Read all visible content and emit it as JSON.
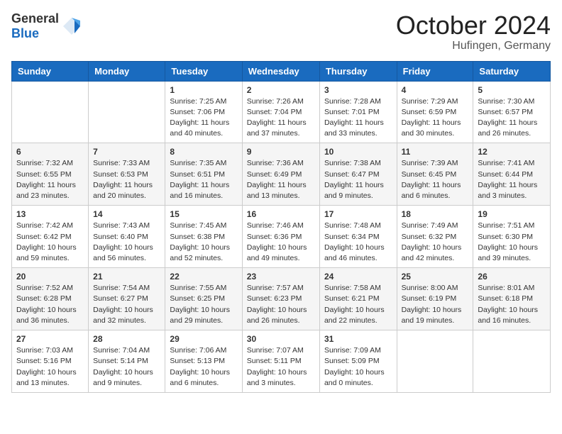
{
  "header": {
    "logo_general": "General",
    "logo_blue": "Blue",
    "month_title": "October 2024",
    "location": "Hufingen, Germany"
  },
  "weekdays": [
    "Sunday",
    "Monday",
    "Tuesday",
    "Wednesday",
    "Thursday",
    "Friday",
    "Saturday"
  ],
  "weeks": [
    [
      {
        "day": "",
        "info": ""
      },
      {
        "day": "",
        "info": ""
      },
      {
        "day": "1",
        "info": "Sunrise: 7:25 AM\nSunset: 7:06 PM\nDaylight: 11 hours and 40 minutes."
      },
      {
        "day": "2",
        "info": "Sunrise: 7:26 AM\nSunset: 7:04 PM\nDaylight: 11 hours and 37 minutes."
      },
      {
        "day": "3",
        "info": "Sunrise: 7:28 AM\nSunset: 7:01 PM\nDaylight: 11 hours and 33 minutes."
      },
      {
        "day": "4",
        "info": "Sunrise: 7:29 AM\nSunset: 6:59 PM\nDaylight: 11 hours and 30 minutes."
      },
      {
        "day": "5",
        "info": "Sunrise: 7:30 AM\nSunset: 6:57 PM\nDaylight: 11 hours and 26 minutes."
      }
    ],
    [
      {
        "day": "6",
        "info": "Sunrise: 7:32 AM\nSunset: 6:55 PM\nDaylight: 11 hours and 23 minutes."
      },
      {
        "day": "7",
        "info": "Sunrise: 7:33 AM\nSunset: 6:53 PM\nDaylight: 11 hours and 20 minutes."
      },
      {
        "day": "8",
        "info": "Sunrise: 7:35 AM\nSunset: 6:51 PM\nDaylight: 11 hours and 16 minutes."
      },
      {
        "day": "9",
        "info": "Sunrise: 7:36 AM\nSunset: 6:49 PM\nDaylight: 11 hours and 13 minutes."
      },
      {
        "day": "10",
        "info": "Sunrise: 7:38 AM\nSunset: 6:47 PM\nDaylight: 11 hours and 9 minutes."
      },
      {
        "day": "11",
        "info": "Sunrise: 7:39 AM\nSunset: 6:45 PM\nDaylight: 11 hours and 6 minutes."
      },
      {
        "day": "12",
        "info": "Sunrise: 7:41 AM\nSunset: 6:44 PM\nDaylight: 11 hours and 3 minutes."
      }
    ],
    [
      {
        "day": "13",
        "info": "Sunrise: 7:42 AM\nSunset: 6:42 PM\nDaylight: 10 hours and 59 minutes."
      },
      {
        "day": "14",
        "info": "Sunrise: 7:43 AM\nSunset: 6:40 PM\nDaylight: 10 hours and 56 minutes."
      },
      {
        "day": "15",
        "info": "Sunrise: 7:45 AM\nSunset: 6:38 PM\nDaylight: 10 hours and 52 minutes."
      },
      {
        "day": "16",
        "info": "Sunrise: 7:46 AM\nSunset: 6:36 PM\nDaylight: 10 hours and 49 minutes."
      },
      {
        "day": "17",
        "info": "Sunrise: 7:48 AM\nSunset: 6:34 PM\nDaylight: 10 hours and 46 minutes."
      },
      {
        "day": "18",
        "info": "Sunrise: 7:49 AM\nSunset: 6:32 PM\nDaylight: 10 hours and 42 minutes."
      },
      {
        "day": "19",
        "info": "Sunrise: 7:51 AM\nSunset: 6:30 PM\nDaylight: 10 hours and 39 minutes."
      }
    ],
    [
      {
        "day": "20",
        "info": "Sunrise: 7:52 AM\nSunset: 6:28 PM\nDaylight: 10 hours and 36 minutes."
      },
      {
        "day": "21",
        "info": "Sunrise: 7:54 AM\nSunset: 6:27 PM\nDaylight: 10 hours and 32 minutes."
      },
      {
        "day": "22",
        "info": "Sunrise: 7:55 AM\nSunset: 6:25 PM\nDaylight: 10 hours and 29 minutes."
      },
      {
        "day": "23",
        "info": "Sunrise: 7:57 AM\nSunset: 6:23 PM\nDaylight: 10 hours and 26 minutes."
      },
      {
        "day": "24",
        "info": "Sunrise: 7:58 AM\nSunset: 6:21 PM\nDaylight: 10 hours and 22 minutes."
      },
      {
        "day": "25",
        "info": "Sunrise: 8:00 AM\nSunset: 6:19 PM\nDaylight: 10 hours and 19 minutes."
      },
      {
        "day": "26",
        "info": "Sunrise: 8:01 AM\nSunset: 6:18 PM\nDaylight: 10 hours and 16 minutes."
      }
    ],
    [
      {
        "day": "27",
        "info": "Sunrise: 7:03 AM\nSunset: 5:16 PM\nDaylight: 10 hours and 13 minutes."
      },
      {
        "day": "28",
        "info": "Sunrise: 7:04 AM\nSunset: 5:14 PM\nDaylight: 10 hours and 9 minutes."
      },
      {
        "day": "29",
        "info": "Sunrise: 7:06 AM\nSunset: 5:13 PM\nDaylight: 10 hours and 6 minutes."
      },
      {
        "day": "30",
        "info": "Sunrise: 7:07 AM\nSunset: 5:11 PM\nDaylight: 10 hours and 3 minutes."
      },
      {
        "day": "31",
        "info": "Sunrise: 7:09 AM\nSunset: 5:09 PM\nDaylight: 10 hours and 0 minutes."
      },
      {
        "day": "",
        "info": ""
      },
      {
        "day": "",
        "info": ""
      }
    ]
  ]
}
